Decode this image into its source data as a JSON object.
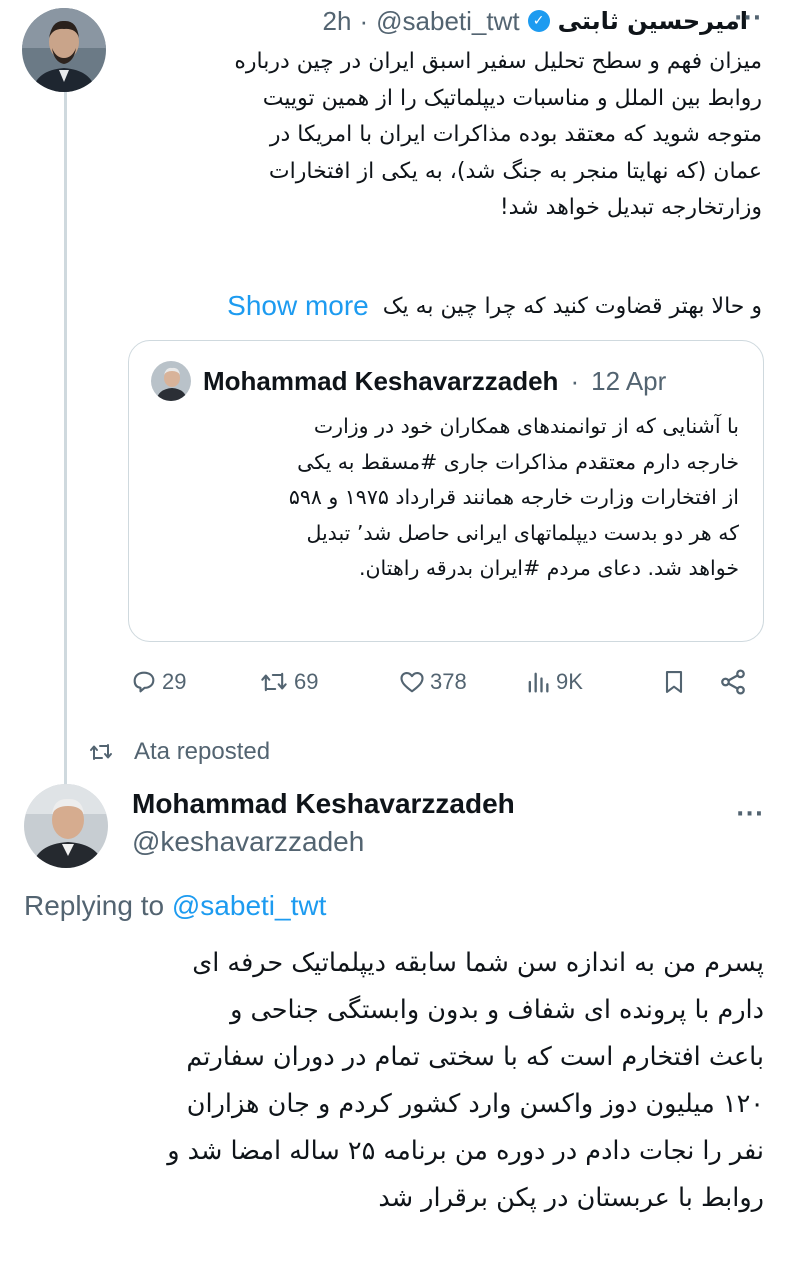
{
  "tweet1": {
    "author_name": "امیرحسین ثابتی",
    "handle": "@sabeti_twt",
    "separator": "·",
    "time": "2h",
    "body_lines": [
      "میزان فهم و سطح تحلیل سفیر اسبق ایران در چین درباره",
      "روابط بین الملل و مناسبات دیپلماتیک را از همین توییت",
      "متوجه شوید که معتقد بوده مذاکرات ایران با امریکا در",
      "عمان (که نهایتا منجر به جنگ شد)، به یکی از افتخارات",
      "وزارتخارجه تبدیل خواهد شد!"
    ],
    "last_line": "و حالا بهتر قضاوت کنید که چرا چین به یک",
    "show_more": "Show more",
    "quote": {
      "author_name": "Mohammad Keshavarzzadeh",
      "separator": "·",
      "time": "12 Apr",
      "body_lines": [
        "با آشنایی که از توانمندهای همکاران خود  در وزارت",
        "خارجه دارم معتقدم  مذاکرات  جاری #مسقط به یکی",
        "از افتخارات وزارت خارجه همانند قرارداد ۱۹۷۵ و ۵۹۸",
        "که هر دو  بدست دیپلماتهای ایرانی حاصل شد’ تبدیل",
        "خواهد شد. دعای مردم  #ایران بدرقه راهتان."
      ]
    },
    "actions": {
      "replies": "29",
      "reposts": "69",
      "likes": "378",
      "views": "9K"
    }
  },
  "repost_label": "Ata reposted",
  "tweet2": {
    "author_name": "Mohammad Keshavarzzadeh",
    "handle": "@keshavarzzadeh",
    "replying_prefix": "Replying to",
    "replying_to": "@sabeti_twt",
    "body_lines": [
      "پسرم من به اندازه سن شما سابقه دیپلماتیک حرفه ای",
      "دارم با پرونده ای شفاف و بدون وابستگی جناحی و",
      "باعث افتخارم است که با سختی تمام در دوران سفارتم",
      "۱۲۰ میلیون دوز واکسن وارد کشور کردم و جان هزاران",
      "نفر را نجات دادم در دوره من برنامه ۲۵ ساله امضا شد و",
      "روابط با عربستان در پکن برقرار شد"
    ]
  },
  "icons": {
    "verified": "verified-badge-icon",
    "more": "more-dots-icon",
    "reply": "reply-icon",
    "repost": "repost-icon",
    "like": "heart-icon",
    "views": "views-chart-icon",
    "bookmark": "bookmark-icon",
    "share": "share-icon"
  },
  "colors": {
    "accent": "#1d9bf0",
    "secondary_text": "#536471",
    "border": "#cfd9de",
    "text": "#0f1419"
  }
}
